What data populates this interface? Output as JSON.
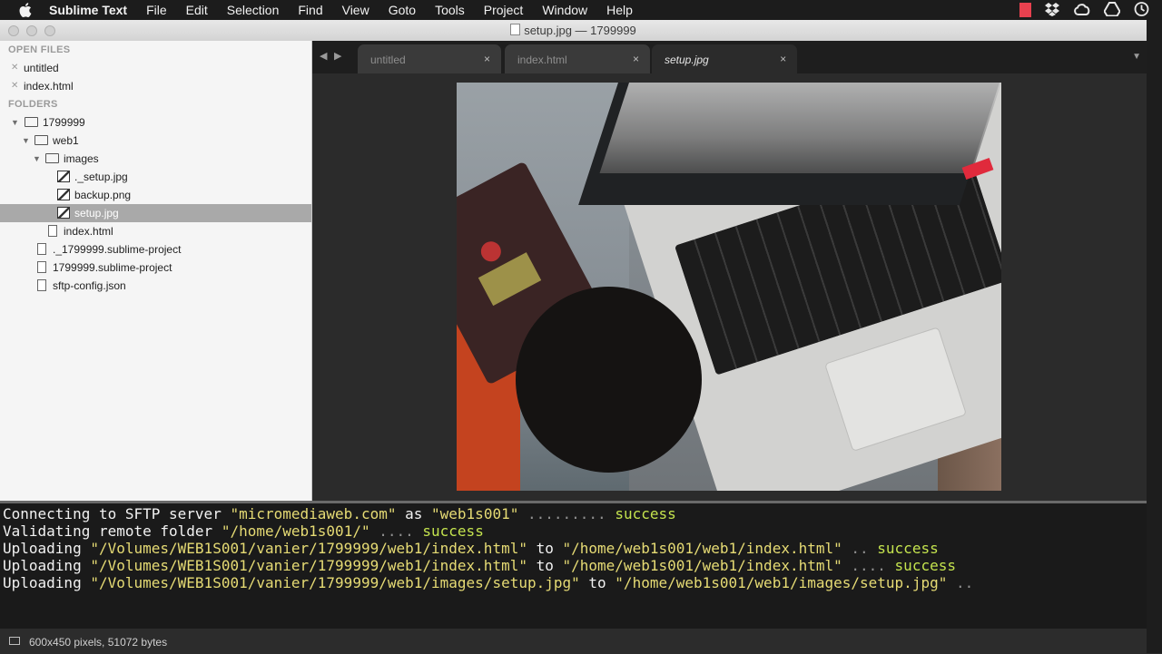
{
  "menubar": {
    "app": "Sublime Text",
    "items": [
      "File",
      "Edit",
      "Selection",
      "Find",
      "View",
      "Goto",
      "Tools",
      "Project",
      "Window",
      "Help"
    ]
  },
  "window": {
    "title": "setup.jpg — 1799999"
  },
  "sidebar": {
    "open_files_header": "OPEN FILES",
    "open_files": [
      "untitled",
      "index.html"
    ],
    "folders_header": "FOLDERS",
    "tree": {
      "root": "1799999",
      "web1": "web1",
      "images": "images",
      "image_files": [
        "._setup.jpg",
        "backup.png",
        "setup.jpg"
      ],
      "web1_files": [
        "index.html"
      ],
      "root_files": [
        "._1799999.sublime-project",
        "1799999.sublime-project",
        "sftp-config.json"
      ]
    }
  },
  "tabs": [
    {
      "label": "untitled",
      "close": "×"
    },
    {
      "label": "index.html",
      "close": "×"
    },
    {
      "label": "setup.jpg",
      "close": "×",
      "active": true
    }
  ],
  "console": {
    "lines": [
      {
        "parts": [
          [
            "Connecting to SFTP server ",
            "t"
          ],
          [
            "\"micromediaweb.com\"",
            "s"
          ],
          [
            " as ",
            "t"
          ],
          [
            "\"web1s001\"",
            "s"
          ],
          [
            " ......... ",
            "d"
          ],
          [
            "success",
            "o"
          ]
        ]
      },
      {
        "parts": [
          [
            "Validating remote folder ",
            "t"
          ],
          [
            "\"/home/web1s001/\"",
            "s"
          ],
          [
            " .... ",
            "d"
          ],
          [
            "success",
            "o"
          ]
        ]
      },
      {
        "parts": [
          [
            "Uploading ",
            "t"
          ],
          [
            "\"/Volumes/WEB1S001/vanier/1799999/web1/index.html\"",
            "s"
          ],
          [
            " to ",
            "t"
          ],
          [
            "\"/home/web1s001/web1/index.html\"",
            "s"
          ],
          [
            " .. ",
            "d"
          ],
          [
            "success",
            "o"
          ]
        ]
      },
      {
        "parts": [
          [
            "Uploading ",
            "t"
          ],
          [
            "\"/Volumes/WEB1S001/vanier/1799999/web1/index.html\"",
            "s"
          ],
          [
            " to ",
            "t"
          ],
          [
            "\"/home/web1s001/web1/index.html\"",
            "s"
          ],
          [
            " .... ",
            "d"
          ],
          [
            "success",
            "o"
          ]
        ]
      },
      {
        "parts": [
          [
            "Uploading ",
            "t"
          ],
          [
            "\"/Volumes/WEB1S001/vanier/1799999/web1/images/setup.jpg\"",
            "s"
          ],
          [
            " to ",
            "t"
          ],
          [
            "\"/home/web1s001/web1/images/setup.jpg\"",
            "s"
          ],
          [
            " ..",
            "d"
          ]
        ]
      }
    ]
  },
  "status": {
    "text": "600x450 pixels, 51072 bytes"
  },
  "colors": {
    "string": "#e6db74",
    "success": "#c4e34e",
    "console_bg": "#1a1a1a",
    "editor_bg": "#2b2b2b"
  },
  "icons": {
    "apple": "apple-icon",
    "tray": [
      "red-box-icon",
      "dropbox-icon",
      "creative-cloud-icon",
      "drive-icon",
      "time-machine-icon"
    ]
  }
}
